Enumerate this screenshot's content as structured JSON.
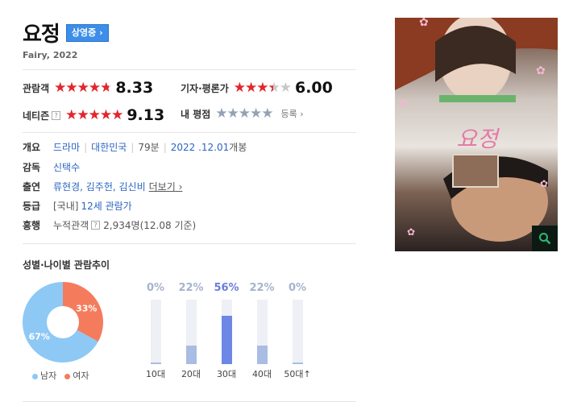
{
  "movie": {
    "title": "요정",
    "status_badge": "상영중",
    "subtitle": "Fairy, 2022"
  },
  "ratings": {
    "audience": {
      "label": "관람객",
      "score": "8.33",
      "fill": 0.833
    },
    "critics": {
      "label": "기자·평론가",
      "score": "6.00",
      "fill": 0.6
    },
    "netizen": {
      "label": "네티즌",
      "score": "9.13",
      "fill": 0.913
    },
    "my": {
      "label": "내 평점",
      "register": "등록"
    }
  },
  "info": {
    "overview_label": "개요",
    "genre": "드라마",
    "country": "대한민국",
    "runtime": "79분",
    "release_date": "2022 .12.01",
    "release_suffix": "개봉",
    "director_label": "감독",
    "director": "신택수",
    "cast_label": "출연",
    "cast": "류현경, 김주헌, 김신비",
    "more": "더보기",
    "grade_label": "등급",
    "grade_prefix": "[국내]",
    "grade": "12세 관람가",
    "boxoffice_label": "흥행",
    "cumulative_label": "누적관객",
    "cumulative_value": "2,934명(12.08 기준)"
  },
  "stats": {
    "section_title": "성별·나이별 관람추이",
    "legend_male": "남자",
    "legend_female": "여자"
  },
  "chart_data": [
    {
      "type": "pie",
      "categories": [
        "남자",
        "여자"
      ],
      "values": [
        67,
        33
      ],
      "labels": [
        "67%",
        "33%"
      ]
    },
    {
      "type": "bar",
      "categories": [
        "10대",
        "20대",
        "30대",
        "40대",
        "50대↑"
      ],
      "values": [
        0,
        22,
        56,
        22,
        0
      ],
      "labels": [
        "0%",
        "22%",
        "56%",
        "22%",
        "0%"
      ],
      "ylim": [
        0,
        100
      ]
    }
  ],
  "colors": {
    "male": "#8ec8f5",
    "female": "#f47c5c",
    "highlight_bar": "#6d87e6",
    "bar": "#a9bce3",
    "star_red": "#e4252b",
    "link": "#2b65c3"
  },
  "icons": {
    "search": "search-icon"
  }
}
